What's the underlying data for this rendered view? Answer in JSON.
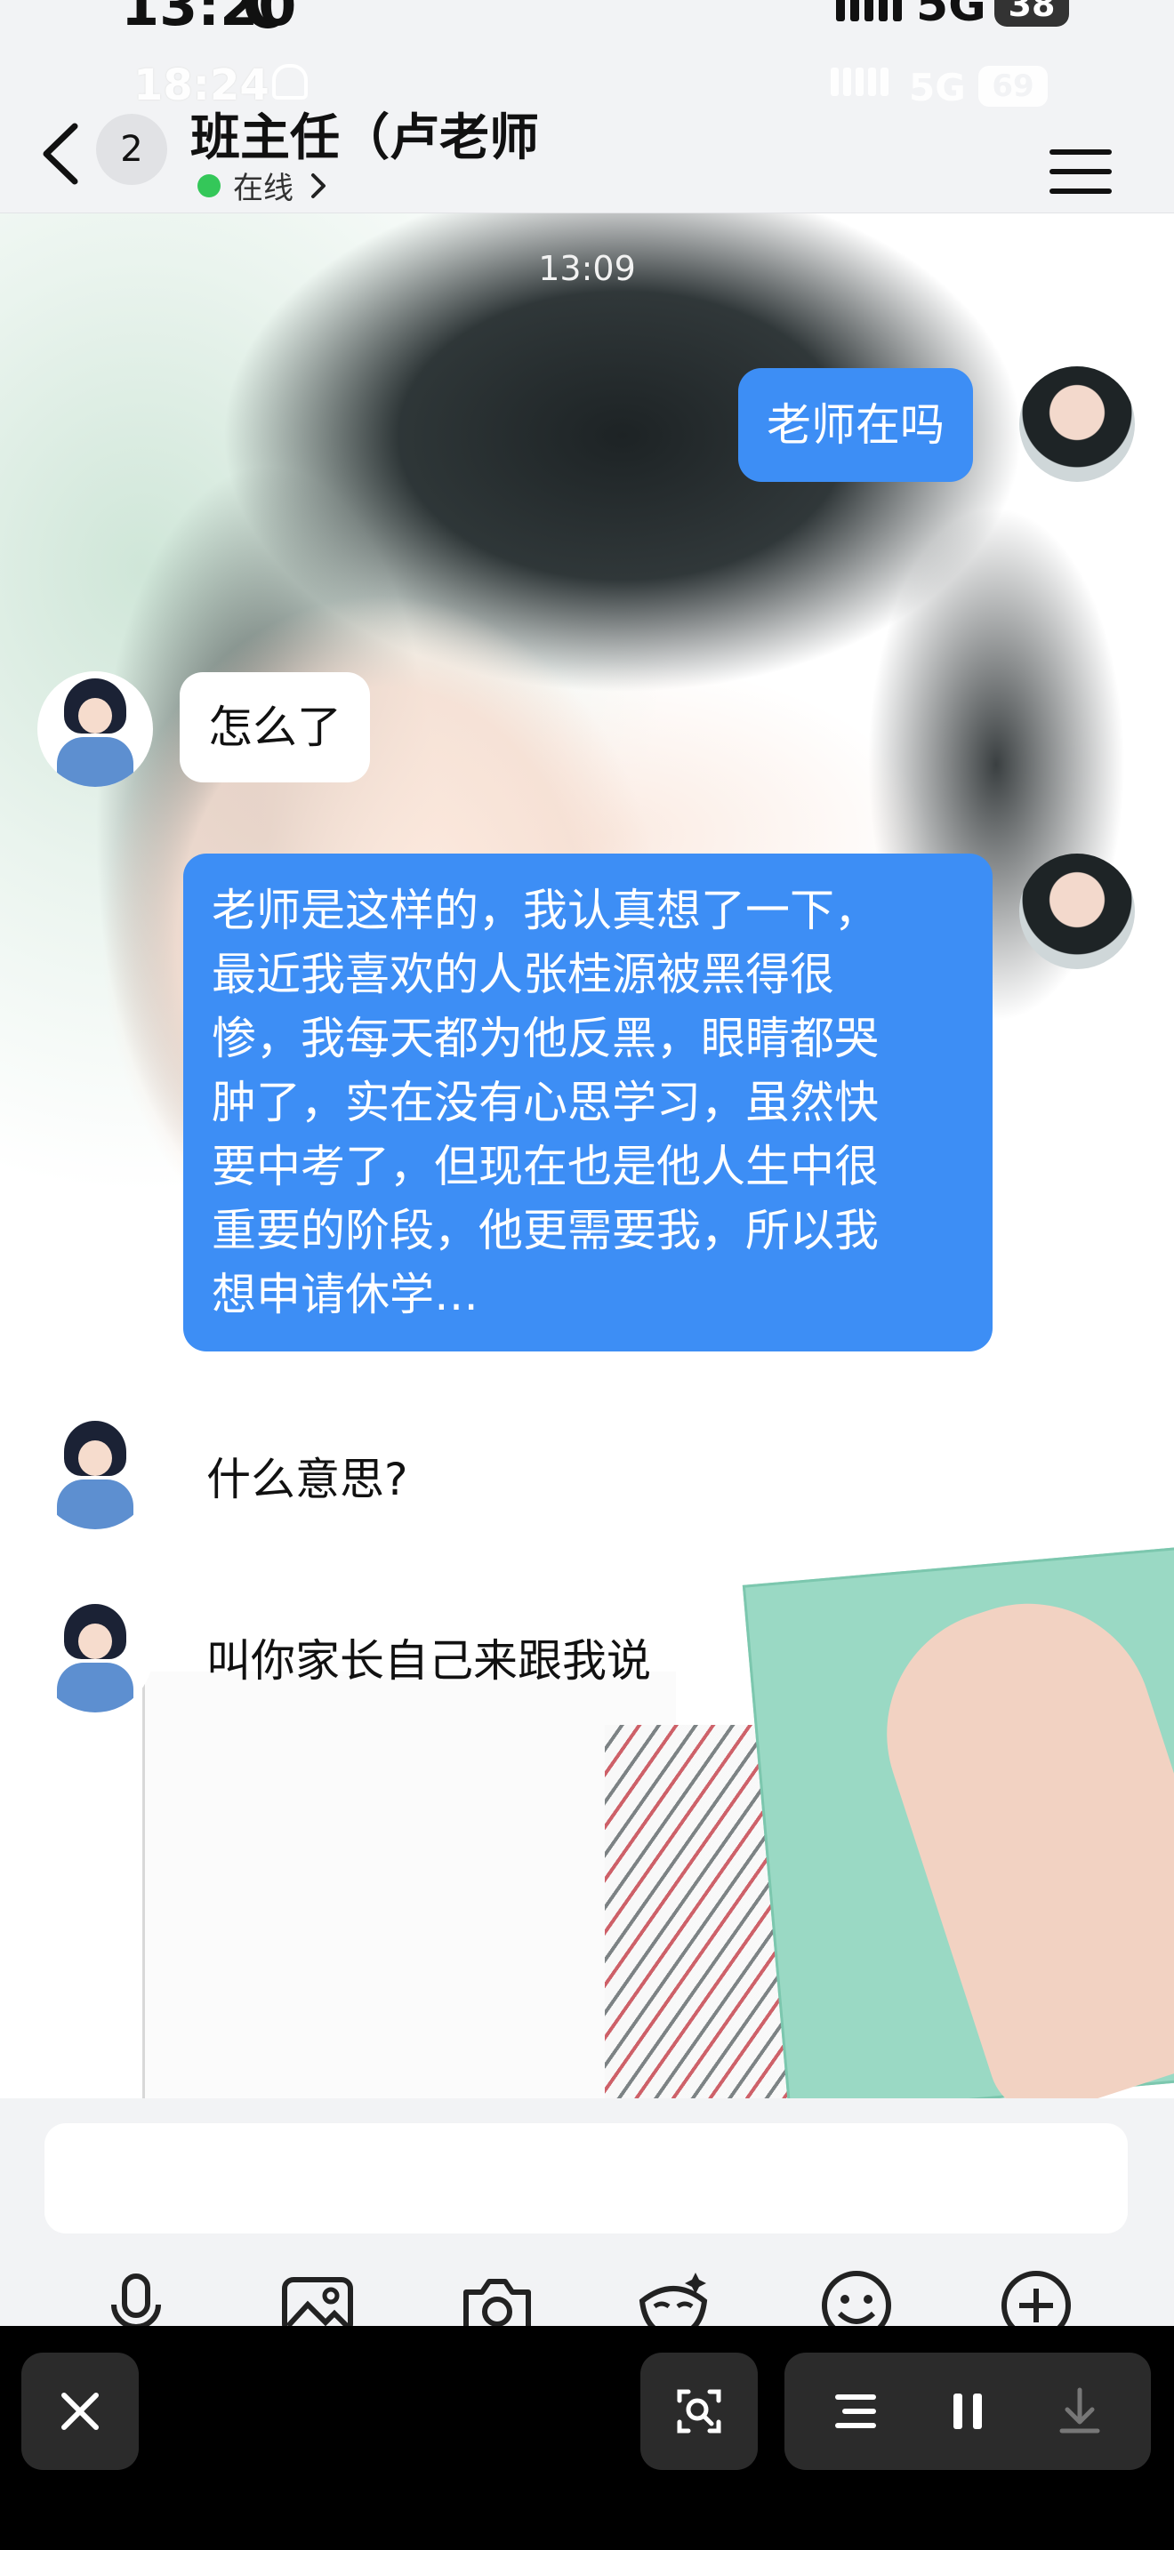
{
  "status_bar": {
    "time": "13:20",
    "network": "5G",
    "battery": "38"
  },
  "status_bar_ghost": {
    "time": "18:24",
    "network": "5G",
    "battery": "69"
  },
  "header": {
    "unread_count": "2",
    "title": "班主任（卢老师",
    "presence": "在线"
  },
  "chat": {
    "timestamp": "13:09",
    "messages": [
      {
        "from": "me",
        "text": "老师在吗"
      },
      {
        "from": "teacher",
        "text": "怎么了"
      },
      {
        "from": "me",
        "lines": [
          "老师是这样的，我认真想了一下，",
          "最近我喜欢的人张桂源被黑得很",
          "惨，我每天都为他反黑，眼睛都哭",
          "肿了，实在没有心思学习，虽然快",
          "要中考了，但现在也是他人生中很",
          "重要的阶段，他更需要我，所以我",
          "想申请休学…"
        ]
      },
      {
        "from": "teacher",
        "text": "什么意思?"
      },
      {
        "from": "teacher",
        "text": "叫你家长自己来跟我说"
      }
    ]
  },
  "input": {
    "placeholder": ""
  },
  "toolbar": [
    "microphone-icon",
    "image-icon",
    "camera-icon",
    "fun-mask-icon",
    "emoji-icon",
    "plus-icon"
  ],
  "overlay": [
    "close-icon",
    "scan-icon",
    "list-icon",
    "pause-icon",
    "download-icon"
  ]
}
